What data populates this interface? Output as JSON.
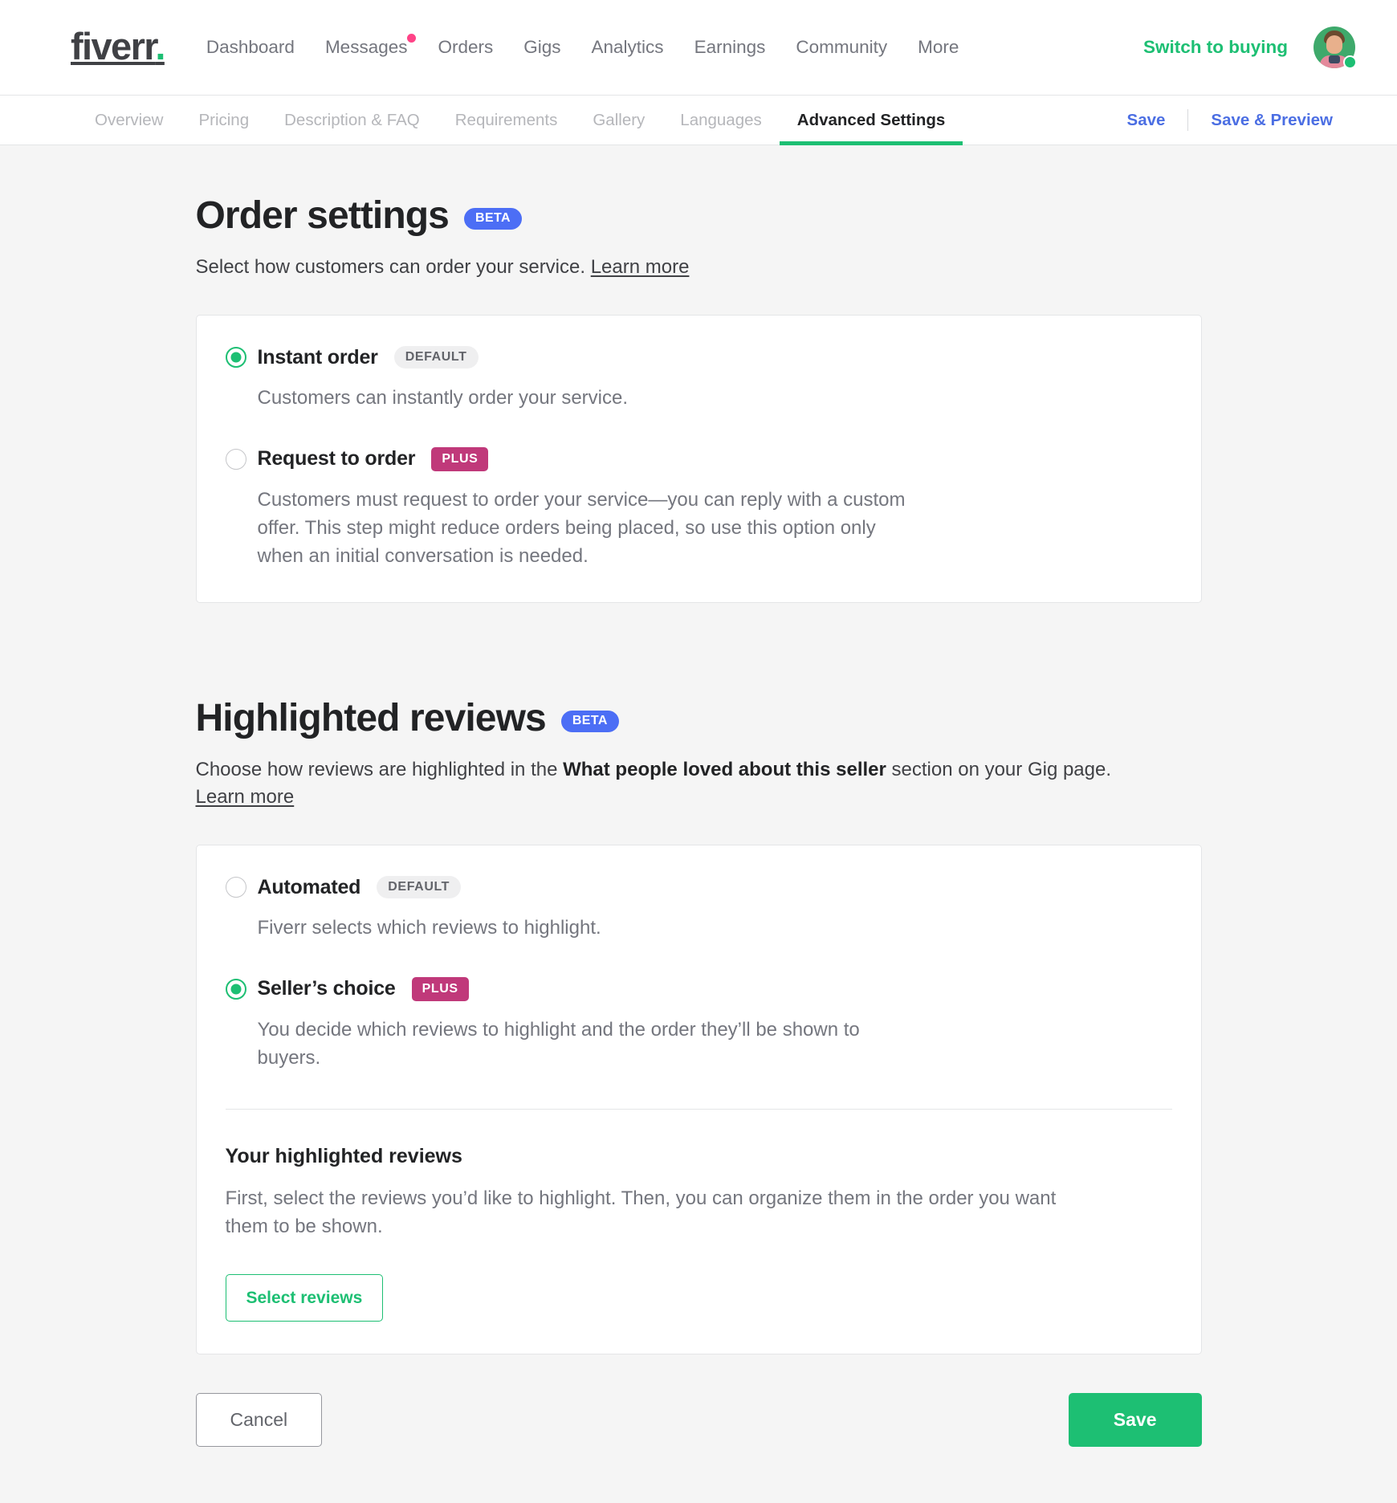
{
  "header": {
    "logo_text": "fiverr",
    "logo_dot": ".",
    "nav": [
      {
        "label": "Dashboard",
        "has_dot": false
      },
      {
        "label": "Messages",
        "has_dot": true
      },
      {
        "label": "Orders",
        "has_dot": false
      },
      {
        "label": "Gigs",
        "has_dot": false
      },
      {
        "label": "Analytics",
        "has_dot": false
      },
      {
        "label": "Earnings",
        "has_dot": false
      },
      {
        "label": "Community",
        "has_dot": false
      },
      {
        "label": "More",
        "has_dot": false
      }
    ],
    "switch_link": "Switch to buying",
    "avatar_name": "user-avatar",
    "online_status": "online"
  },
  "subnav": {
    "tabs": [
      {
        "label": "Overview",
        "active": false
      },
      {
        "label": "Pricing",
        "active": false
      },
      {
        "label": "Description & FAQ",
        "active": false
      },
      {
        "label": "Requirements",
        "active": false
      },
      {
        "label": "Gallery",
        "active": false
      },
      {
        "label": "Languages",
        "active": false
      },
      {
        "label": "Advanced Settings",
        "active": true
      }
    ],
    "save_label": "Save",
    "save_preview_label": "Save & Preview"
  },
  "order_settings": {
    "title": "Order settings",
    "badge": "BETA",
    "description": "Select how customers can order your service.",
    "learn_more": "Learn more",
    "options": [
      {
        "label": "Instant order",
        "tag": "DEFAULT",
        "tag_type": "default",
        "selected": true,
        "description": "Customers can instantly order your service."
      },
      {
        "label": "Request to order",
        "tag": "PLUS",
        "tag_type": "plus",
        "selected": false,
        "description": "Customers must request to order your service—you can reply with a custom offer. This step might reduce orders being placed, so use this option only when an initial conversation is needed."
      }
    ]
  },
  "highlighted_reviews": {
    "title": "Highlighted reviews",
    "badge": "BETA",
    "desc_part1": "Choose how reviews are highlighted in the ",
    "desc_bold": "What people loved about this seller",
    "desc_part2": " section on your Gig page.",
    "learn_more": "Learn more",
    "options": [
      {
        "label": "Automated",
        "tag": "DEFAULT",
        "tag_type": "default",
        "selected": false,
        "description": "Fiverr selects which reviews to highlight."
      },
      {
        "label": "Seller’s choice",
        "tag": "PLUS",
        "tag_type": "plus",
        "selected": true,
        "description": "You decide which reviews to highlight and the order they’ll be shown to buyers."
      }
    ],
    "sub_heading": "Your highlighted reviews",
    "sub_description": "First, select the reviews you’d like to highlight. Then, you can organize them in the order you want them to be shown.",
    "select_reviews_label": "Select reviews"
  },
  "footer": {
    "cancel_label": "Cancel",
    "save_label": "Save"
  },
  "colors": {
    "brand_green": "#1dbf73",
    "beta_blue": "#4c6ef5",
    "plus_magenta": "#c0397a",
    "link_blue": "#4b6ee3",
    "page_bg": "#f5f5f5"
  }
}
